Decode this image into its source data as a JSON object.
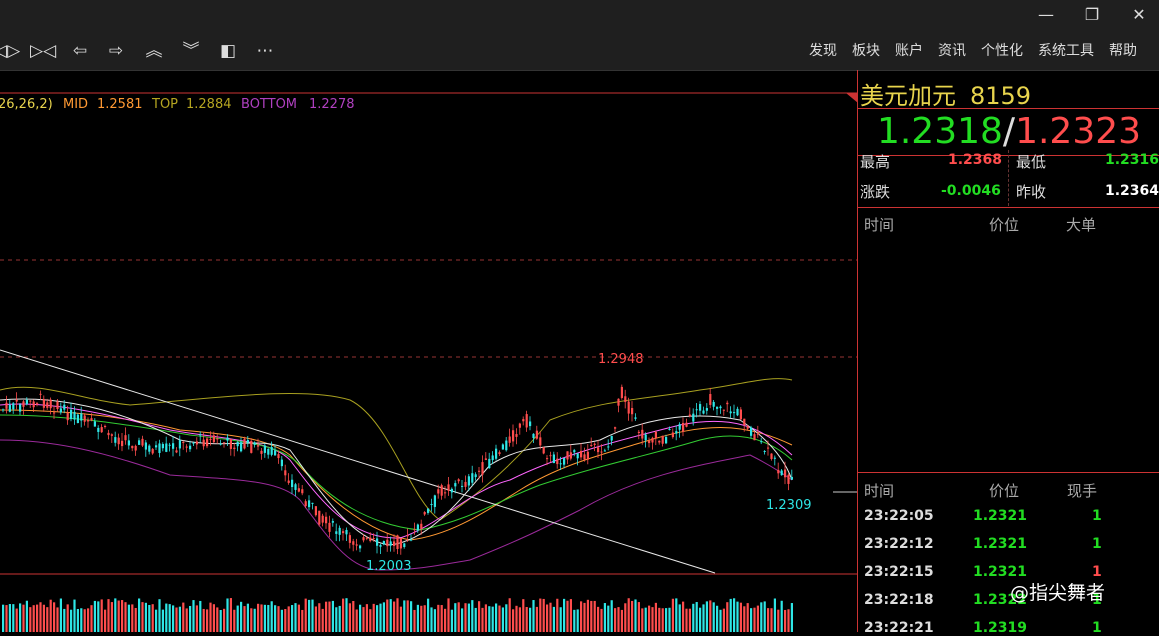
{
  "window": {
    "minimize_icon": "—",
    "restore_icon": "❐",
    "close_icon": "✕"
  },
  "toolbar": {
    "icons": [
      "◁▷",
      "▷◁",
      "⇦",
      "⇨",
      "︽",
      "︾",
      "◧",
      "⋯"
    ],
    "menu": [
      "发现",
      "板块",
      "账户",
      "资讯",
      "个性化",
      "系统工具",
      "帮助"
    ]
  },
  "indicator": {
    "params": "26,26,2)",
    "mid_label": "MID",
    "mid_value": "1.2581",
    "top_label": "TOP",
    "top_value": "1.2884",
    "bottom_label": "BOTTOM",
    "bottom_value": "1.2278"
  },
  "chart_labels": {
    "high": "1.2948",
    "low": "1.2003",
    "last": "1.2309"
  },
  "quote": {
    "name": "美元加元",
    "code": "8159",
    "bid": "1.2318",
    "sep": "/",
    "ask": "1.2323",
    "high_label": "最高",
    "high": "1.2368",
    "low_label": "最低",
    "low": "1.2316",
    "change_label": "涨跌",
    "change": "-0.0046",
    "prev_close_label": "昨收",
    "prev_close": "1.2364"
  },
  "big_orders": {
    "col_time": "时间",
    "col_price": "价位",
    "col_size": "大单"
  },
  "ticks": {
    "col_time": "时间",
    "col_price": "价位",
    "col_volume": "现手",
    "rows": [
      {
        "time": "23:22:05",
        "price": "1.2321",
        "vol": "1",
        "dir": "up"
      },
      {
        "time": "23:22:12",
        "price": "1.2321",
        "vol": "1",
        "dir": "up"
      },
      {
        "time": "23:22:15",
        "price": "1.2321",
        "vol": "1",
        "dir": "down"
      },
      {
        "time": "23:22:18",
        "price": "1.2322",
        "vol": "1",
        "dir": "up"
      },
      {
        "time": "23:22:21",
        "price": "1.2319",
        "vol": "1",
        "dir": "up"
      }
    ]
  },
  "watermark": "@指尖舞者",
  "colors": {
    "up": "#ff4d4d",
    "down": "#2ee6e6",
    "green": "#22dd22",
    "yellow": "#e8d44d",
    "purple": "#b040c0",
    "orange": "#ff9933",
    "frame": "#cc3333"
  }
}
